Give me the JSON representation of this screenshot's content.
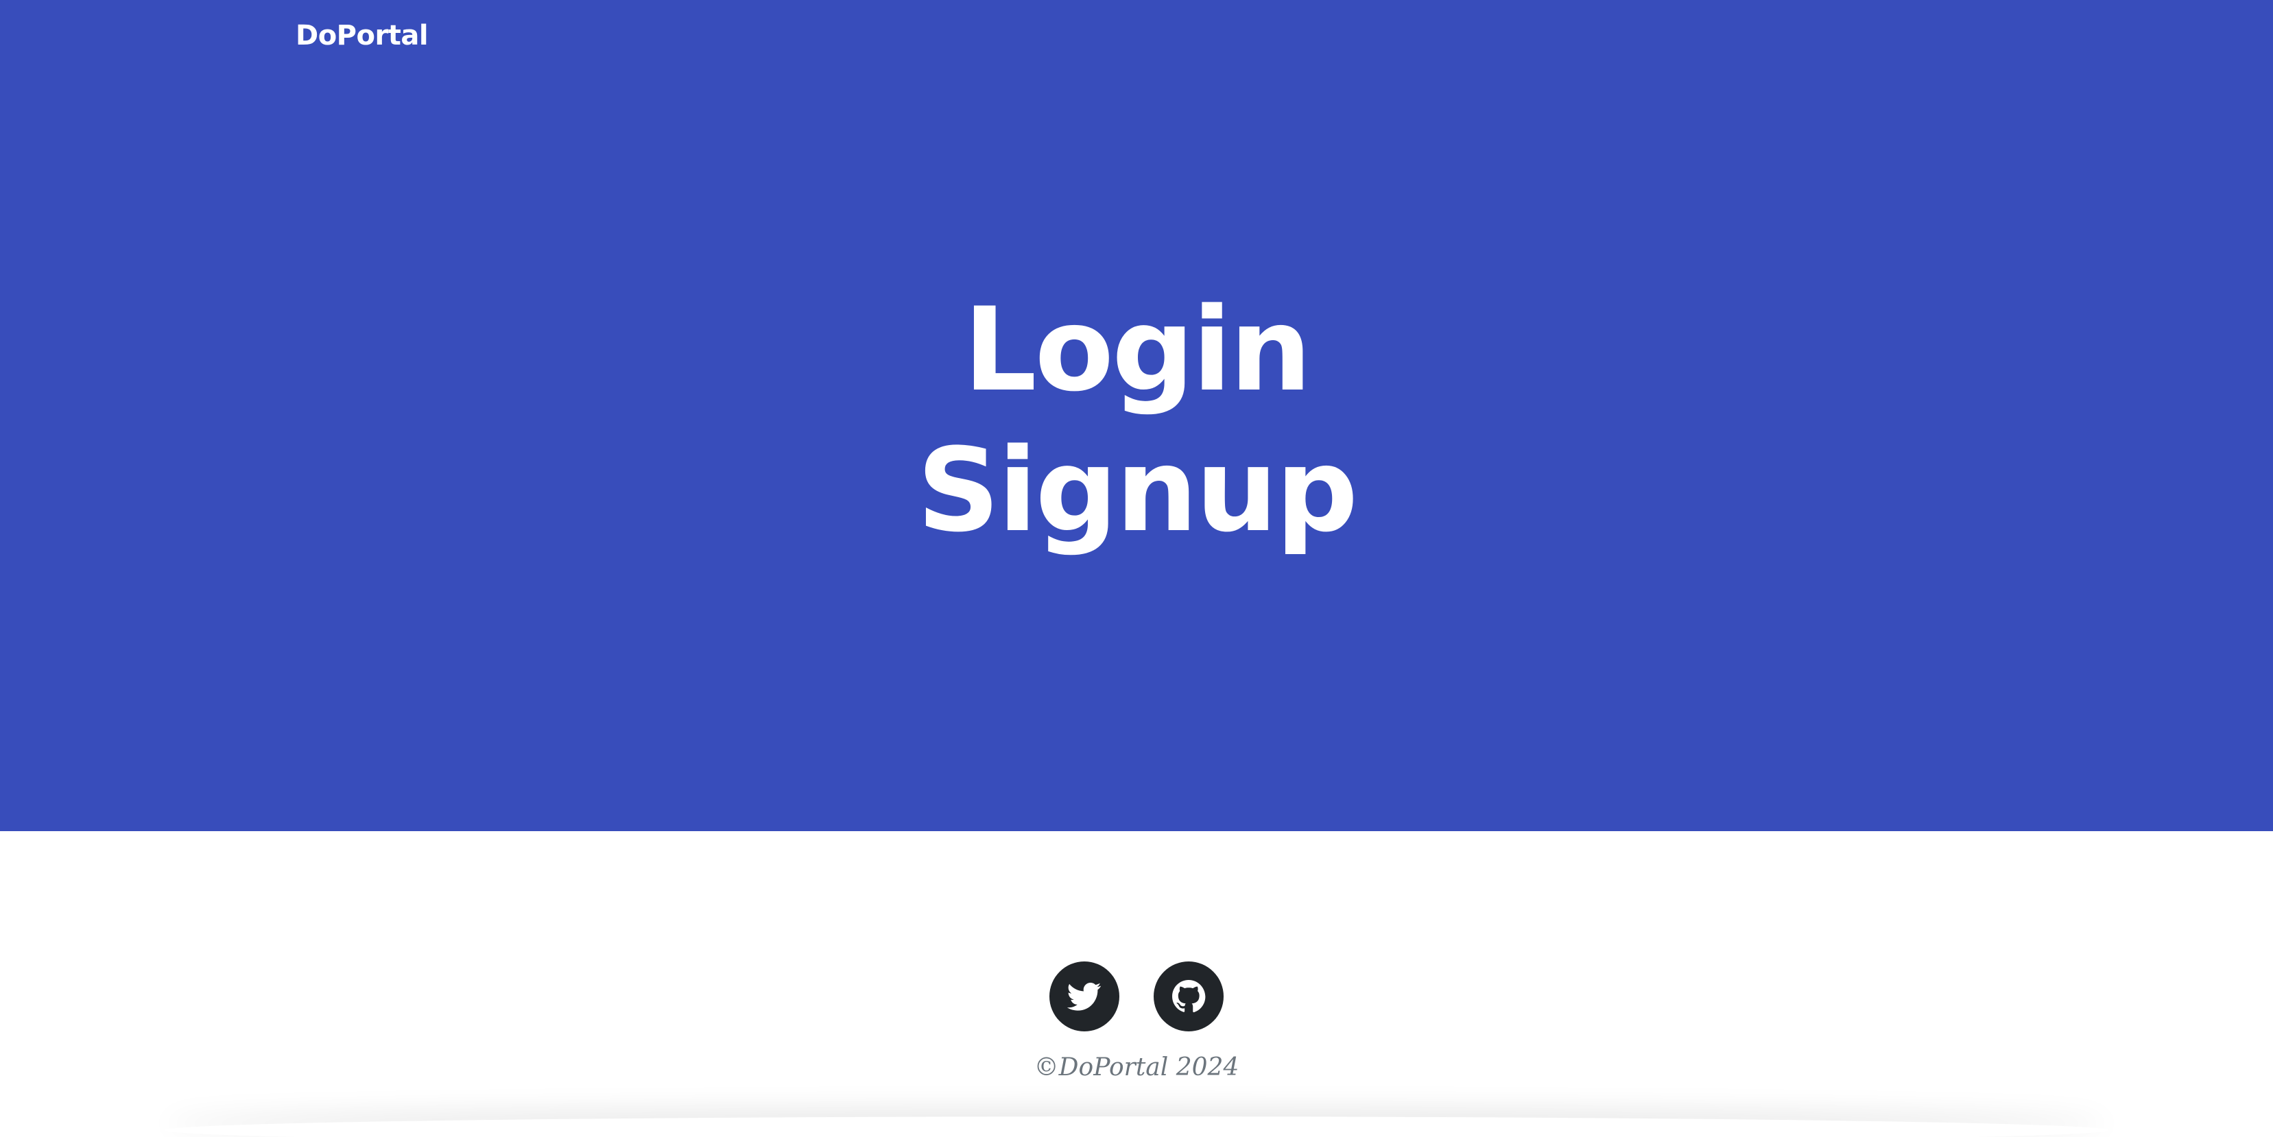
{
  "header": {
    "brand": "DoPortal"
  },
  "hero": {
    "links": [
      {
        "label": "Login"
      },
      {
        "label": "Signup"
      }
    ]
  },
  "footer": {
    "social": [
      {
        "icon": "twitter-icon"
      },
      {
        "icon": "github-icon"
      }
    ],
    "copyright": "©DoPortal 2024"
  },
  "colors": {
    "hero_background": "#384dbb",
    "hero_text": "#ffffff",
    "social_circle": "#212529",
    "footer_text": "#6c757d"
  }
}
